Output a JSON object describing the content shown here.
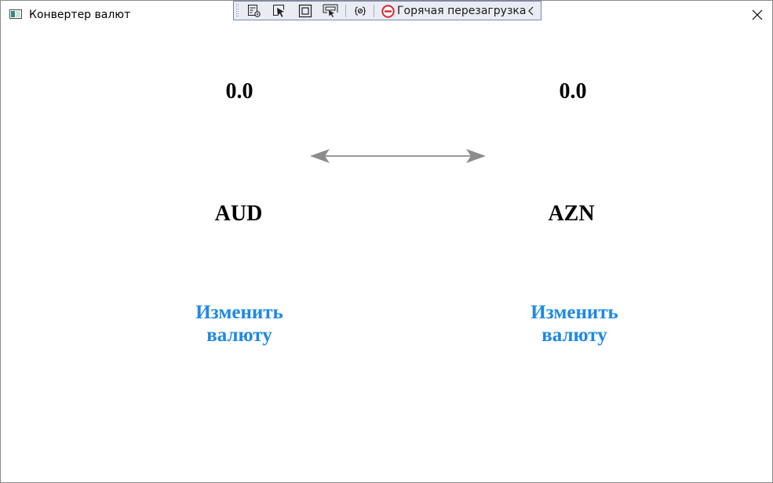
{
  "window": {
    "title": "Конвертер валют",
    "close_icon": "close-icon"
  },
  "devtools": {
    "hot_reload_label": "Горячая перезагрузка",
    "icons": [
      "live-visual-tree-icon",
      "select-element-icon",
      "display-layout-adorners-icon",
      "track-focus-icon",
      "binding-failures-icon",
      "hot-reload-stop-icon",
      "chevron-left-icon"
    ]
  },
  "converter": {
    "left": {
      "value": "0.0",
      "currency": "AUD",
      "change_label": "Изменить валюту"
    },
    "right": {
      "value": "0.0",
      "currency": "AZN",
      "change_label": "Изменить валюту"
    },
    "swap_icon": "swap-arrow-icon"
  },
  "colors": {
    "accent": "#1e88e5",
    "arrow": "#8c8c8c",
    "devbar_bg": "#e9ecf3",
    "devbar_border": "#7c86b4",
    "hot_reload_red": "#d9262e"
  }
}
